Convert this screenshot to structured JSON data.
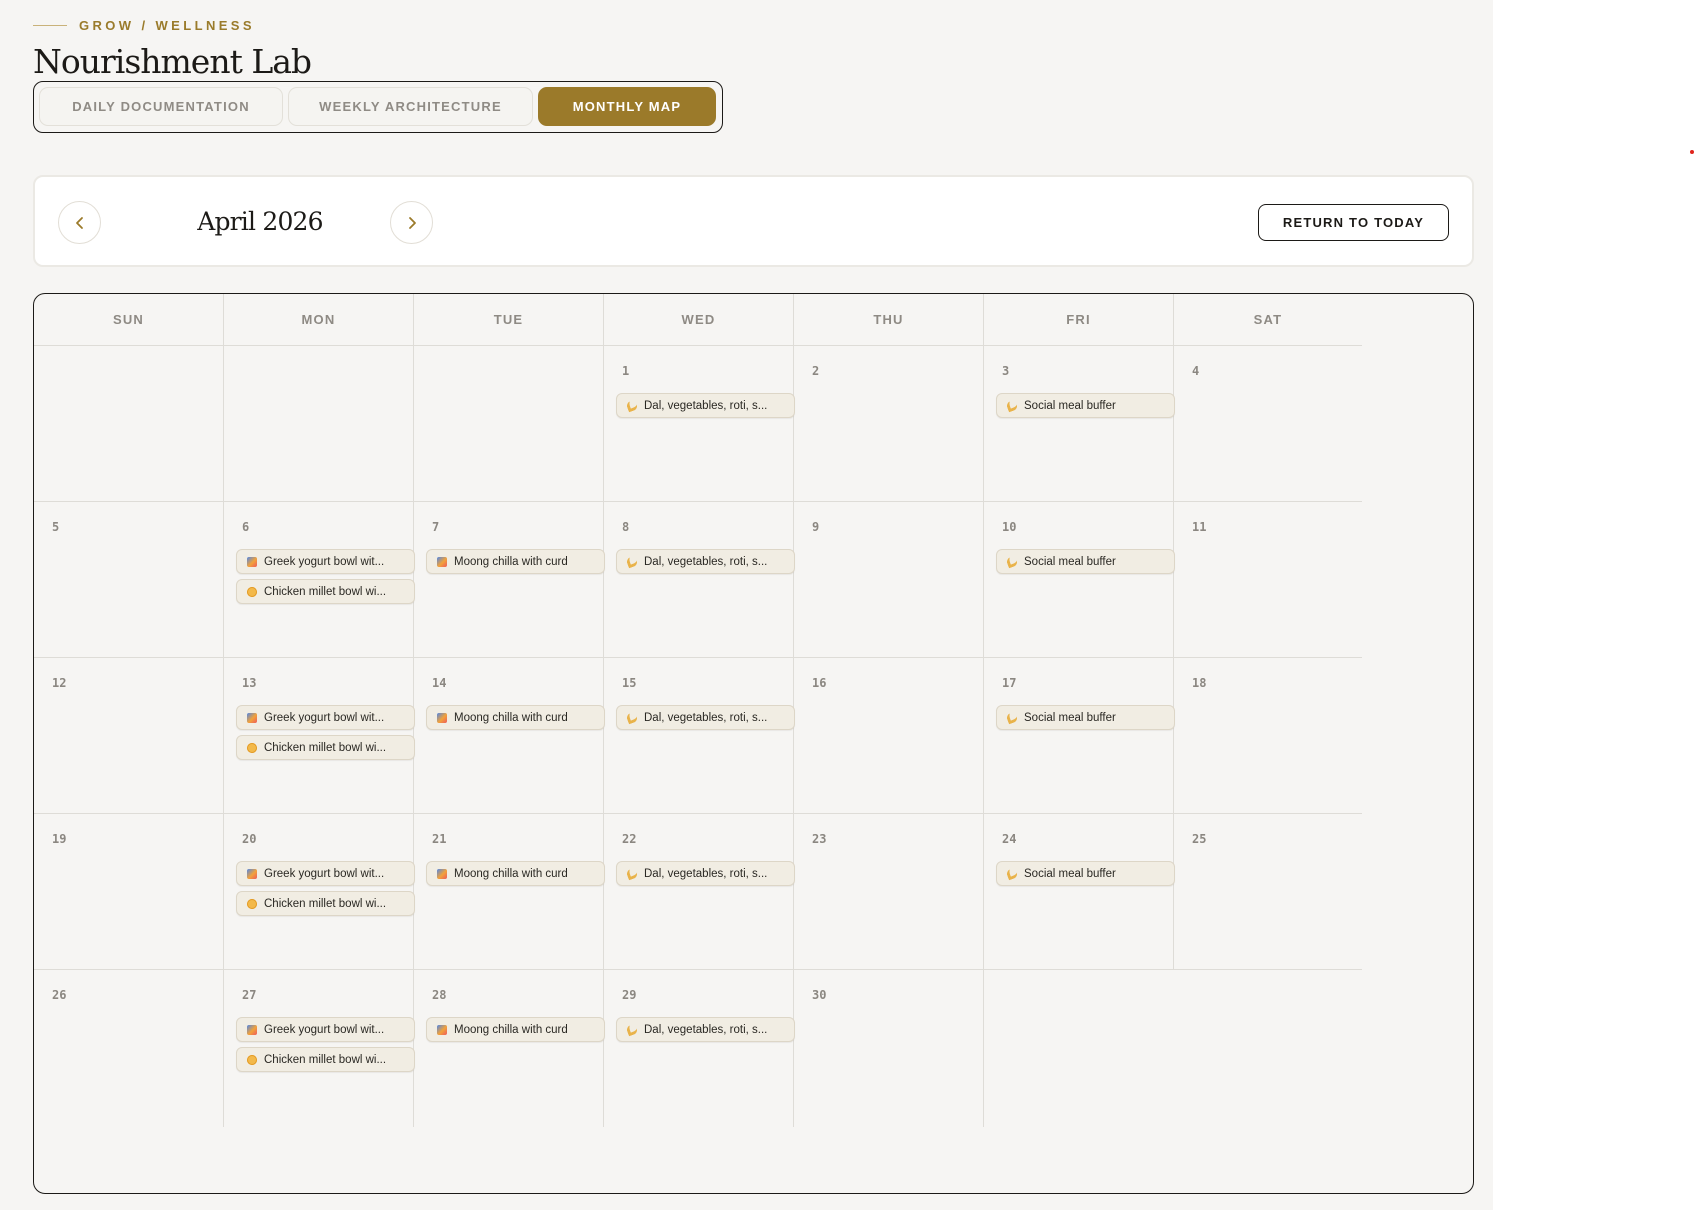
{
  "header": {
    "eyebrow": "GROW / WELLNESS",
    "title": "Nourishment Lab"
  },
  "tabs": [
    {
      "label": "DAILY DOCUMENTATION",
      "active": false
    },
    {
      "label": "WEEKLY ARCHITECTURE",
      "active": false
    },
    {
      "label": "MONTHLY MAP",
      "active": true
    }
  ],
  "month_nav": {
    "prev_icon": "chevron-left-icon",
    "label": "April 2026",
    "next_icon": "chevron-right-icon",
    "today_label": "RETURN TO TODAY"
  },
  "colors": {
    "accent": "#9b7a2a",
    "background": "#f6f5f3",
    "border": "#1c1a17"
  },
  "calendar": {
    "weekdays": [
      "SUN",
      "MON",
      "TUE",
      "WED",
      "THU",
      "FRI",
      "SAT"
    ],
    "weeks": [
      [
        {
          "day": "",
          "meals": []
        },
        {
          "day": "",
          "meals": []
        },
        {
          "day": "",
          "meals": []
        },
        {
          "day": "1",
          "meals": [
            {
              "icon": "dinner-icon",
              "text": "Dal, vegetables, roti, s..."
            }
          ]
        },
        {
          "day": "2",
          "meals": []
        },
        {
          "day": "3",
          "meals": [
            {
              "icon": "dinner-icon",
              "text": "Social meal buffer"
            }
          ]
        },
        {
          "day": "4",
          "meals": []
        }
      ],
      [
        {
          "day": "5",
          "meals": []
        },
        {
          "day": "6",
          "meals": [
            {
              "icon": "breakfast-icon",
              "text": "Greek yogurt bowl wit..."
            },
            {
              "icon": "lunch-icon",
              "text": "Chicken millet bowl wi..."
            }
          ]
        },
        {
          "day": "7",
          "meals": [
            {
              "icon": "breakfast-icon",
              "text": "Moong chilla with curd"
            }
          ]
        },
        {
          "day": "8",
          "meals": [
            {
              "icon": "dinner-icon",
              "text": "Dal, vegetables, roti, s..."
            }
          ]
        },
        {
          "day": "9",
          "meals": []
        },
        {
          "day": "10",
          "meals": [
            {
              "icon": "dinner-icon",
              "text": "Social meal buffer"
            }
          ]
        },
        {
          "day": "11",
          "meals": []
        }
      ],
      [
        {
          "day": "12",
          "meals": []
        },
        {
          "day": "13",
          "meals": [
            {
              "icon": "breakfast-icon",
              "text": "Greek yogurt bowl wit..."
            },
            {
              "icon": "lunch-icon",
              "text": "Chicken millet bowl wi..."
            }
          ]
        },
        {
          "day": "14",
          "meals": [
            {
              "icon": "breakfast-icon",
              "text": "Moong chilla with curd"
            }
          ]
        },
        {
          "day": "15",
          "meals": [
            {
              "icon": "dinner-icon",
              "text": "Dal, vegetables, roti, s..."
            }
          ]
        },
        {
          "day": "16",
          "meals": []
        },
        {
          "day": "17",
          "meals": [
            {
              "icon": "dinner-icon",
              "text": "Social meal buffer"
            }
          ]
        },
        {
          "day": "18",
          "meals": []
        }
      ],
      [
        {
          "day": "19",
          "meals": []
        },
        {
          "day": "20",
          "meals": [
            {
              "icon": "breakfast-icon",
              "text": "Greek yogurt bowl wit..."
            },
            {
              "icon": "lunch-icon",
              "text": "Chicken millet bowl wi..."
            }
          ]
        },
        {
          "day": "21",
          "meals": [
            {
              "icon": "breakfast-icon",
              "text": "Moong chilla with curd"
            }
          ]
        },
        {
          "day": "22",
          "meals": [
            {
              "icon": "dinner-icon",
              "text": "Dal, vegetables, roti, s..."
            }
          ]
        },
        {
          "day": "23",
          "meals": []
        },
        {
          "day": "24",
          "meals": [
            {
              "icon": "dinner-icon",
              "text": "Social meal buffer"
            }
          ]
        },
        {
          "day": "25",
          "meals": []
        }
      ],
      [
        {
          "day": "26",
          "meals": []
        },
        {
          "day": "27",
          "meals": [
            {
              "icon": "breakfast-icon",
              "text": "Greek yogurt bowl wit..."
            },
            {
              "icon": "lunch-icon",
              "text": "Chicken millet bowl wi..."
            }
          ]
        },
        {
          "day": "28",
          "meals": [
            {
              "icon": "breakfast-icon",
              "text": "Moong chilla with curd"
            }
          ]
        },
        {
          "day": "29",
          "meals": [
            {
              "icon": "dinner-icon",
              "text": "Dal, vegetables, roti, s..."
            }
          ]
        },
        {
          "day": "30",
          "meals": []
        }
      ]
    ]
  }
}
